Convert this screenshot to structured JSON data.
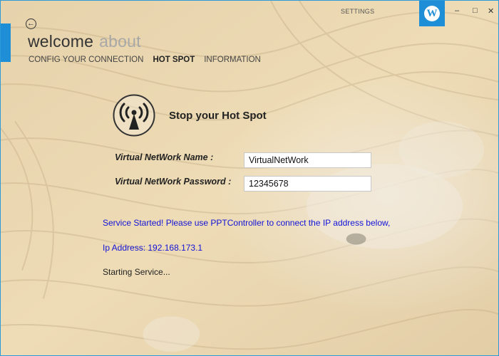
{
  "header": {
    "title": "welcome",
    "secondary_title": "about",
    "settings_label": "SETTINGS",
    "minimize_glyph": "–",
    "maximize_glyph": "□",
    "close_glyph": "✕",
    "back_glyph": "←",
    "wp_glyph": "W"
  },
  "tabs": [
    {
      "label": "CONFIG YOUR CONNECTION",
      "active": false
    },
    {
      "label": "HOT SPOT",
      "active": true
    },
    {
      "label": "INFORMATION",
      "active": false
    }
  ],
  "hotspot": {
    "title": "Stop your Hot Spot",
    "name_label": "Virtual NetWork Name :",
    "name_value": "VirtualNetWork",
    "password_label": "Virtual NetWork Password :",
    "password_value": "12345678"
  },
  "status": {
    "service_message": "Service Started! Please use PPTController to connect the IP address below,",
    "ip_line": "Ip Address: 192.168.173.1",
    "progress_message": "Starting Service..."
  },
  "colors": {
    "accent": "#1e8fd6",
    "status_blue": "#1212d8"
  }
}
